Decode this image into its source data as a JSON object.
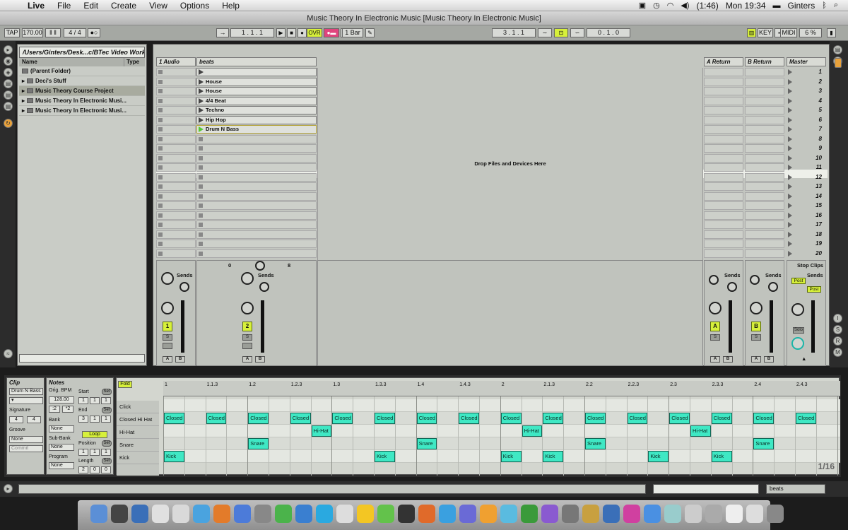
{
  "menubar": {
    "apple": "",
    "app": "Live",
    "items": [
      "File",
      "Edit",
      "Create",
      "View",
      "Options",
      "Help"
    ],
    "battery": "(1:46)",
    "clock": "Mon 19:34",
    "user": "Ginters"
  },
  "window": {
    "title": "Music Theory In Electronic Music  [Music Theory In Electronic Music]"
  },
  "transport": {
    "tap": "TAP",
    "bpm": "170.00",
    "signature": "4  /  4",
    "position": "1 .   1 .   1",
    "ovr": "OVR",
    "quantize": "1 Bar",
    "loop_start": "3 .   1 .   1",
    "loop_length": "0 .   1 .   0",
    "key": "KEY",
    "midi": "MIDI",
    "cpu": "6 %"
  },
  "browser": {
    "path": "/Users/Ginters/Desk...c/BTec Video Work/",
    "col_name": "Name",
    "col_type": "Type",
    "items": [
      "(Parent Folder)",
      "Deci's Stuff",
      "Music Theory Course Project",
      "Music Theory In Electronic Musi...",
      "Music Theory In Electronic Musi..."
    ]
  },
  "session": {
    "tracks": [
      "1 Audio",
      "beats",
      "A Return",
      "B Return",
      "Master"
    ],
    "clips": [
      "",
      "House",
      "House",
      "4/4 Beat",
      "Techno",
      "Hip Hop",
      "Drum N Bass"
    ],
    "scenes": [
      "1",
      "2",
      "3",
      "4",
      "5",
      "6",
      "7",
      "8",
      "9",
      "10",
      "11",
      "12",
      "13",
      "14",
      "15",
      "16",
      "17",
      "18",
      "19",
      "20"
    ],
    "drop_text": "Drop Files and Devices Here",
    "stop_clips": "Stop Clips",
    "sends": "Sends",
    "track_numbers": [
      "1",
      "2"
    ],
    "return_letters": [
      "A",
      "B"
    ],
    "solo": "S",
    "a_btn": "A",
    "b_btn": "B",
    "post": "Post",
    "solo_label": "Solo",
    "crossfade_left": "0",
    "crossfade_right": "8"
  },
  "clip": {
    "title": "Clip",
    "name": "Drum N Bass",
    "signature_label": "Signature",
    "sig_num": "4",
    "sig_den": "4",
    "groove_label": "Groove",
    "groove_value": "None",
    "commit": "Commit"
  },
  "notes": {
    "title": "Notes",
    "orig_bpm_label": "Orig. BPM",
    "orig_bpm": "128.00",
    "half": ":2",
    "double": "*2",
    "bank_label": "Bank",
    "bank_value": "None",
    "subbank_label": "Sub-Bank",
    "subbank_value": "None",
    "program_label": "Program",
    "program_value": "None",
    "start_label": "Start",
    "start_value": [
      "1",
      "1",
      "1"
    ],
    "end_label": "End",
    "end_value": [
      "3",
      "1",
      "1"
    ],
    "loop": "Loop",
    "position_label": "Position",
    "position_value": [
      "1",
      "1",
      "1"
    ],
    "length_label": "Length",
    "length_value": [
      "2",
      "0",
      "0"
    ],
    "set": "Set"
  },
  "editor": {
    "fold": "Fold",
    "rows": [
      "Click",
      "Closed Hi Hat",
      "Hi-Hat",
      "Snare",
      "Kick"
    ],
    "ruler": [
      "1",
      "1.1.3",
      "1.2",
      "1.2.3",
      "1.3",
      "1.3.3",
      "1.4",
      "1.4.3",
      "2",
      "2.1.3",
      "2.2",
      "2.2.3",
      "2.3",
      "2.3.3",
      "2.4",
      "2.4.3"
    ],
    "grid_label": "1/16",
    "notes": [
      {
        "row": 1,
        "step": 0,
        "text": "Closed"
      },
      {
        "row": 1,
        "step": 2,
        "text": "Closed"
      },
      {
        "row": 1,
        "step": 4,
        "text": "Closed"
      },
      {
        "row": 1,
        "step": 6,
        "text": "Closed"
      },
      {
        "row": 1,
        "step": 8,
        "text": "Closed"
      },
      {
        "row": 1,
        "step": 10,
        "text": "Closed"
      },
      {
        "row": 1,
        "step": 12,
        "text": "Closed"
      },
      {
        "row": 1,
        "step": 14,
        "text": "Closed"
      },
      {
        "row": 1,
        "step": 16,
        "text": "Closed"
      },
      {
        "row": 1,
        "step": 18,
        "text": "Closed"
      },
      {
        "row": 1,
        "step": 20,
        "text": "Closed"
      },
      {
        "row": 1,
        "step": 22,
        "text": "Closed"
      },
      {
        "row": 1,
        "step": 24,
        "text": "Closed"
      },
      {
        "row": 1,
        "step": 26,
        "text": "Closed"
      },
      {
        "row": 1,
        "step": 28,
        "text": "Closed"
      },
      {
        "row": 1,
        "step": 30,
        "text": "Closed"
      },
      {
        "row": 2,
        "step": 7,
        "text": "Hi-Hat"
      },
      {
        "row": 2,
        "step": 17,
        "text": "Hi-Hat"
      },
      {
        "row": 2,
        "step": 25,
        "text": "Hi-Hat"
      },
      {
        "row": 3,
        "step": 4,
        "text": "Snare"
      },
      {
        "row": 3,
        "step": 12,
        "text": "Snare"
      },
      {
        "row": 3,
        "step": 20,
        "text": "Snare"
      },
      {
        "row": 3,
        "step": 28,
        "text": "Snare"
      },
      {
        "row": 4,
        "step": 0,
        "text": "Kick"
      },
      {
        "row": 4,
        "step": 10,
        "text": "Kick"
      },
      {
        "row": 4,
        "step": 16,
        "text": "Kick"
      },
      {
        "row": 4,
        "step": 18,
        "text": "Kick"
      },
      {
        "row": 4,
        "step": 23,
        "text": "Kick"
      },
      {
        "row": 4,
        "step": 26,
        "text": "Kick"
      }
    ]
  },
  "status": {
    "track_name": "beats"
  },
  "colors": {
    "note": "#3fe8c4",
    "accent": "#d7f03a",
    "record": "#e0457e"
  }
}
